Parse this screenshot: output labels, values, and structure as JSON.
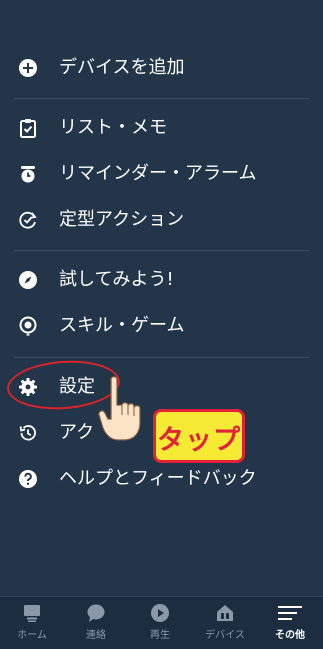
{
  "menu": {
    "group1": [
      {
        "label": "デバイスを追加",
        "icon": "plus-circle-icon"
      }
    ],
    "group2": [
      {
        "label": "リスト・メモ",
        "icon": "clipboard-check-icon"
      },
      {
        "label": "リマインダー・アラーム",
        "icon": "alarm-clock-icon"
      },
      {
        "label": "定型アクション",
        "icon": "routine-check-icon"
      }
    ],
    "group3": [
      {
        "label": "試してみよう!",
        "icon": "compass-icon"
      },
      {
        "label": "スキル・ゲーム",
        "icon": "skills-icon"
      }
    ],
    "group4": [
      {
        "label": "設定",
        "icon": "gear-icon"
      },
      {
        "label": "アク",
        "icon": "history-icon"
      },
      {
        "label": "ヘルプとフィードバック",
        "icon": "help-icon"
      }
    ]
  },
  "tabbar": {
    "tabs": [
      {
        "label": "ホーム",
        "icon": "home-icon"
      },
      {
        "label": "連絡",
        "icon": "chat-bubble-icon"
      },
      {
        "label": "再生",
        "icon": "play-icon"
      },
      {
        "label": "デバイス",
        "icon": "devices-icon"
      },
      {
        "label": "その他",
        "icon": "menu-lines-icon",
        "active": true
      }
    ]
  },
  "annotation": {
    "tap_text": "タップ",
    "highlight_color": "#d8232a",
    "badge_color": "#f6ea35"
  },
  "colors": {
    "background": "#223549",
    "tabbar_background": "#1c2d3f",
    "text": "#ffffff",
    "inactive_tab_text": "#8a98a8"
  }
}
